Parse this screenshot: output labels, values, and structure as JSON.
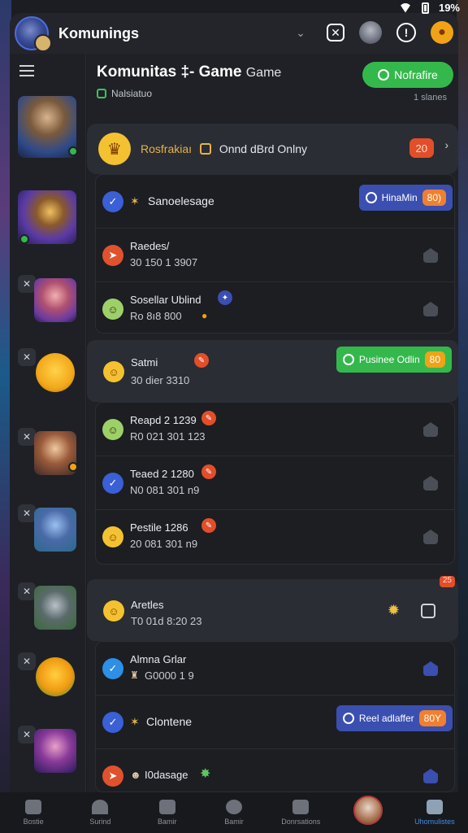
{
  "status": {
    "battery": "19%"
  },
  "app": {
    "title": "Komunings"
  },
  "appbar": {
    "icons": [
      "chevron-down-icon",
      "x-square-icon",
      "hero-avatar-icon",
      "info-icon",
      "notification-icon"
    ]
  },
  "header": {
    "title": "Komunitas ‡- Game",
    "title_suffix": "Game",
    "subtitle": "Nalsiatuo",
    "button": "Nofrafire",
    "meta": "1 slanes"
  },
  "featured": {
    "label": "Rosfrakiaı",
    "text": "Onnd dBrd Onlny",
    "badge": "20"
  },
  "group1": {
    "rows": [
      {
        "title": "Sanoelesage",
        "pill": "HinaMin",
        "tag": "80)",
        "icon": "check-icon",
        "color": "#3a5fd6"
      },
      {
        "title": "Raedes/",
        "sub": "30 150 1 3907",
        "icon": "arrow-icon",
        "color": "#e0522e"
      },
      {
        "title": "Sosellar Ublind",
        "sub": "Ro 8ı8 800",
        "icon": "smile-icon",
        "color": "#9ed06a"
      }
    ]
  },
  "solo1": {
    "title": "Satmi",
    "sub": "30 dier 3310",
    "pill": "Pusinee Odlin",
    "tag": "80"
  },
  "group2": {
    "rows": [
      {
        "title": "Reapd 2 1239",
        "sub": "R0 021 301 123",
        "icon": "smile-icon",
        "color": "#9ed06a"
      },
      {
        "title": "Teaed 2 1280",
        "sub": "N0 081 301 n9",
        "icon": "check-icon",
        "color": "#3a5fd6"
      },
      {
        "title": "Pestile 1286",
        "sub": "20 081 301 n9",
        "icon": "smile-icon",
        "color": "#f4c230"
      }
    ]
  },
  "solo2": {
    "title": "Aretles",
    "sub": "T0 01d 8:20 23",
    "corner": "25"
  },
  "group3": {
    "rows": [
      {
        "title": "Almna Grlar",
        "sub": "G0000 1 9",
        "icon": "check-icon",
        "color": "#2d8fe6"
      },
      {
        "title": "Clontene",
        "pill": "Reel adlaffer",
        "tag": "80Y",
        "icon": "check-icon",
        "color": "#3a5fd6"
      },
      {
        "title": "I0dasage",
        "icon": "arrow-icon",
        "color": "#e0522e"
      }
    ]
  },
  "bottomnav": {
    "items": [
      "Bostie",
      "Surind",
      "Bamir",
      "Bamir",
      "Donrsations",
      "",
      "Uhomulistes"
    ]
  },
  "colors": {
    "accent_green": "#34b84c",
    "accent_blue": "#3a4fb0",
    "accent_orange": "#f0a316"
  }
}
